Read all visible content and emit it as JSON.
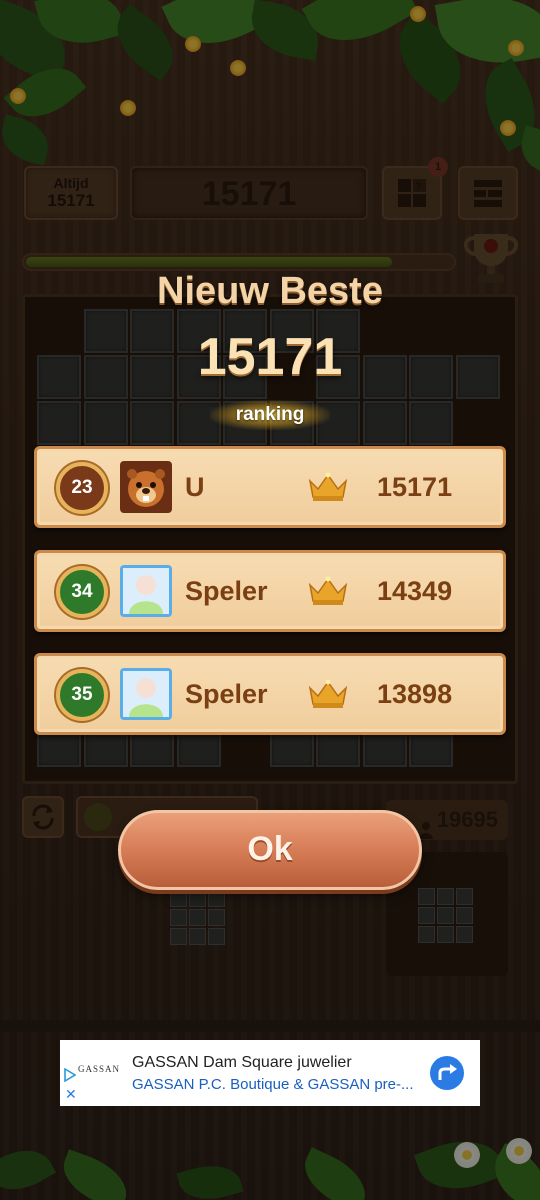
{
  "header": {
    "best_label": "Altijd",
    "best_value": "15171",
    "current_score": "15171",
    "notification_count": "1"
  },
  "progress": {
    "fraction": 0.86
  },
  "popup": {
    "title": "Nieuw Beste",
    "score": "15171",
    "ranking_label": "ranking",
    "rows": [
      {
        "rank": "23",
        "name": "U",
        "score": "15171",
        "avatar": "beaver",
        "badge_color": "#7a3a1a"
      },
      {
        "rank": "34",
        "name": "Speler",
        "score": "14349",
        "avatar": "default-person",
        "badge_color": "#2f7a2a"
      },
      {
        "rank": "35",
        "name": "Speler",
        "score": "13898",
        "avatar": "default-person",
        "badge_color": "#2f7a2a"
      }
    ],
    "ok_label": "Ok"
  },
  "controls": {
    "rank_number": "19695"
  },
  "ad": {
    "brand": "GASSAN",
    "line1": "GASSAN Dam Square juwelier",
    "line2": "GASSAN P.C. Boutique & GASSAN pre-..."
  },
  "icons": {
    "trophy": "trophy-icon",
    "crown": "crown-icon",
    "refresh": "refresh-icon",
    "go": "arrow-turn-icon"
  }
}
